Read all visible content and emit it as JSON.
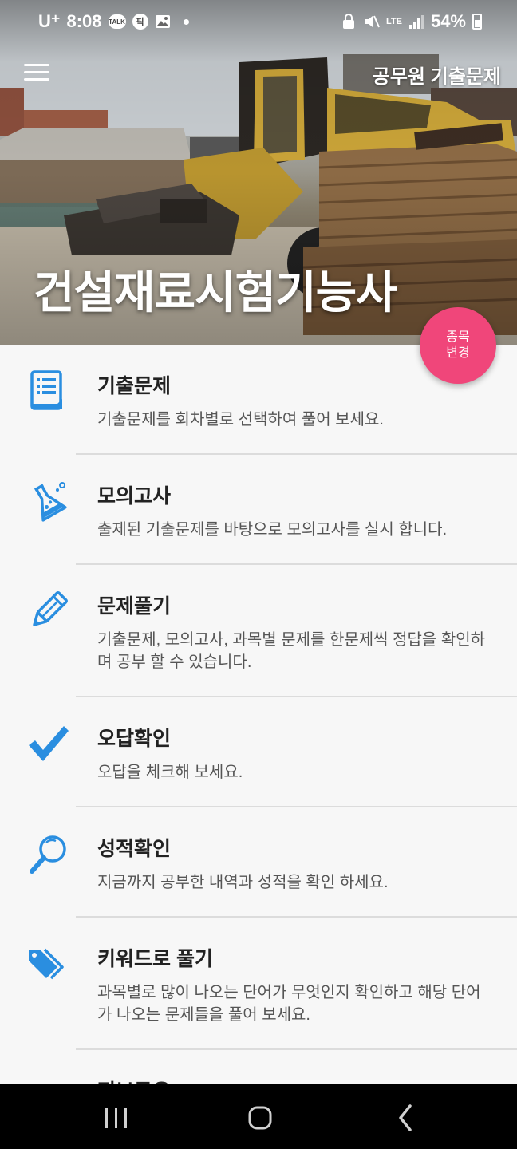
{
  "status_bar": {
    "carrier": "U⁺",
    "time": "8:08",
    "notification_icons": [
      "talk-icon",
      "pill-icon",
      "image-icon"
    ],
    "system_icons": [
      "lock-icon",
      "mute-icon",
      "lte-icon",
      "signal-icon"
    ],
    "lte_label": "LTE",
    "battery": "54%"
  },
  "app_bar": {
    "title": "공무원 기출문제"
  },
  "hero": {
    "title": "건설재료시험기능사",
    "fab_label_1": "종목",
    "fab_label_2": "변경"
  },
  "menu": {
    "items": [
      {
        "title": "기출문제",
        "desc": "기출문제를 회차별로 선택하여 풀어 보세요.",
        "icon": "document-icon"
      },
      {
        "title": "모의고사",
        "desc": "출제된 기출문제를 바탕으로 모의고사를 실시 합니다.",
        "icon": "flask-icon"
      },
      {
        "title": "문제풀기",
        "desc": "기출문제, 모의고사, 과목별 문제를 한문제씩 정답을 확인하며 공부 할 수 있습니다.",
        "icon": "pencil-icon"
      },
      {
        "title": "오답확인",
        "desc": "오답을 체크해 보세요.",
        "icon": "checkmark-icon"
      },
      {
        "title": "성적확인",
        "desc": "지금까지 공부한 내역과 성적을 확인 하세요.",
        "icon": "magnifier-icon"
      },
      {
        "title": "키워드로 풀기",
        "desc": "과목별로 많이 나오는 단어가 무엇인지 확인하고 해당 단어가 나오는 문제들을 풀어 보세요.",
        "icon": "tags-icon"
      },
      {
        "title": "정보공유",
        "desc": "",
        "icon": "share-icon"
      }
    ]
  },
  "colors": {
    "accent": "#2a8ee0",
    "fab": "#f0467a"
  }
}
